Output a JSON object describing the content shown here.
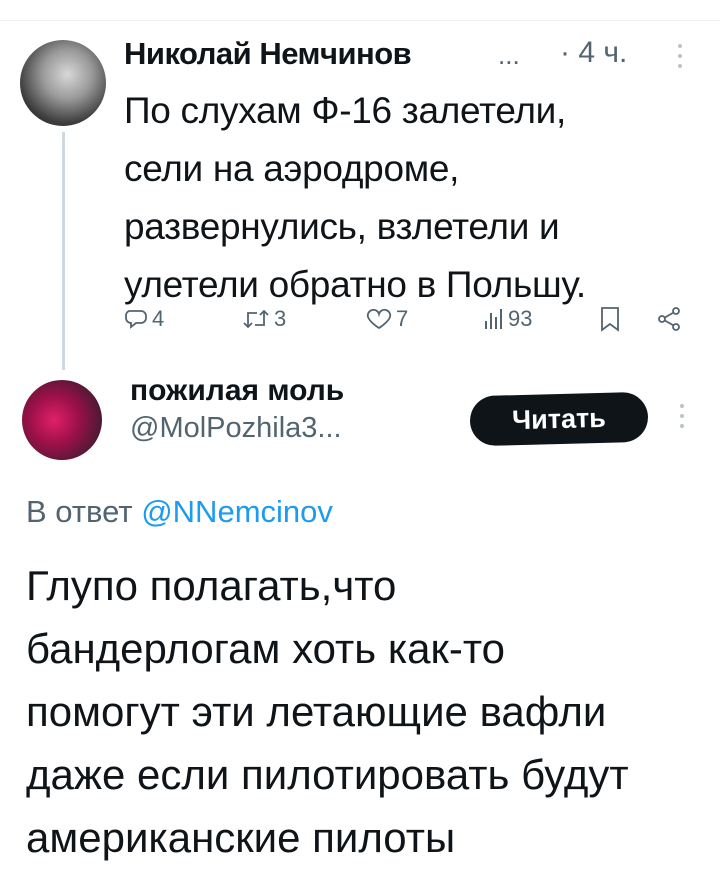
{
  "tweet": {
    "author_name": "Николай Немчинов",
    "name_ellipsis": "...",
    "time": "· 4 ч.",
    "text": "По слухам Ф-16 залетели,\nсели на аэродроме,\nразвернулись, взлетели и\nулетели обратно в Польшу.",
    "actions": {
      "replies": "4",
      "retweets": "3",
      "likes": "7",
      "views": "93"
    }
  },
  "reply": {
    "author_name": "пожилая моль",
    "handle": "@MolPozhila3...",
    "follow_label": "Читать",
    "reply_prefix": "В ответ",
    "reply_handle": "@NNemcinov",
    "text": "Глупо полагать,что\nбандерлогам хоть как-то\nпомогут эти летающие вафли\nдаже если пилотировать будут\nамериканские пилоты"
  },
  "colors": {
    "text": "#0f1419",
    "secondary": "#536471",
    "link": "#1d9bf0",
    "thread_line": "#cfd9de"
  },
  "icons": [
    "reply-icon",
    "retweet-icon",
    "like-icon",
    "views-icon",
    "bookmark-icon",
    "share-icon",
    "more-icon"
  ]
}
